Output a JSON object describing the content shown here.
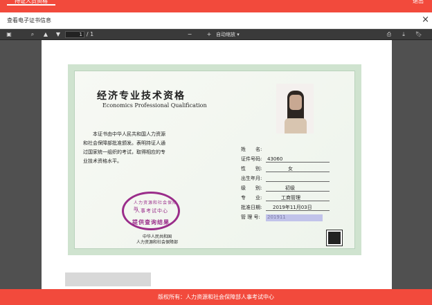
{
  "topbar": {
    "left": "持证人员资格",
    "right": "退出"
  },
  "titlebar": {
    "title": "查看电子证书信息",
    "close": "×"
  },
  "toolbar": {
    "page_current": "1",
    "page_total": "/ 1",
    "zoom_minus": "−",
    "zoom_plus": "+",
    "zoom_value": "自动缩放"
  },
  "certificate": {
    "title_cn": "经济专业技术资格",
    "title_en": "Economics Professional Qualification",
    "body_lines": [
      "本证书由中华人民共和国人力资源",
      "和社会保障部批准颁发。表明持证人通",
      "过国家统一组织的考试，取得相应的专",
      "业技术资格水平。"
    ],
    "fields": [
      {
        "label": "姓　　名:",
        "value": ""
      },
      {
        "label": "证件号码:",
        "value": "43060"
      },
      {
        "label": "性　　别:",
        "value": "女"
      },
      {
        "label": "出生年月:",
        "value": ""
      },
      {
        "label": "级　　别:",
        "value": "初级"
      },
      {
        "label": "专　　业:",
        "value": "工商管理"
      },
      {
        "label": "批准日期:",
        "value": "2019年11月03日"
      },
      {
        "label": "管 理 号:",
        "value": "201911"
      }
    ],
    "seal_lines": [
      "人力资源和社会保障部",
      "人事考试中心",
      "提供查询结果"
    ],
    "issuer_lines": [
      "中华人民共和国",
      "人力资源和社会保障部"
    ]
  },
  "footer": {
    "text": "版权所有：人力资源和社会保障部人事考试中心"
  }
}
